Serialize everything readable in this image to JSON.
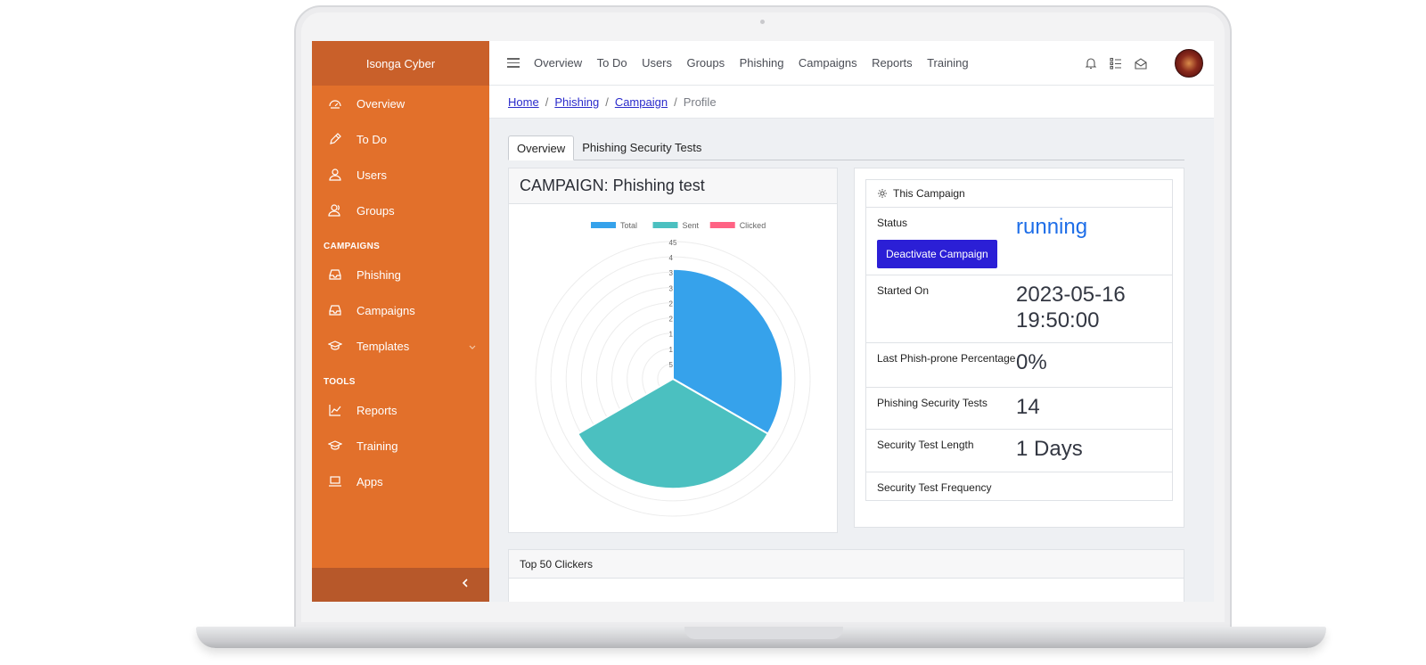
{
  "app": {
    "brand": "Isonga Cyber"
  },
  "sidebar": {
    "items": [
      {
        "label": "Overview",
        "icon": "dashboard-icon"
      },
      {
        "label": "To Do",
        "icon": "pencil-icon"
      },
      {
        "label": "Users",
        "icon": "user-icon"
      },
      {
        "label": "Groups",
        "icon": "group-icon"
      }
    ],
    "campaigns_heading": "CAMPAIGNS",
    "campaign_items": [
      {
        "label": "Phishing",
        "icon": "inbox-icon"
      },
      {
        "label": "Campaigns",
        "icon": "inbox-icon"
      },
      {
        "label": "Templates",
        "icon": "graduation-icon"
      }
    ],
    "tools_heading": "TOOLS",
    "tool_items": [
      {
        "label": "Reports",
        "icon": "chart-line-icon"
      },
      {
        "label": "Training",
        "icon": "graduation-icon"
      },
      {
        "label": "Apps",
        "icon": "laptop-icon"
      }
    ]
  },
  "topnav": [
    "Overview",
    "To Do",
    "Users",
    "Groups",
    "Phishing",
    "Campaigns",
    "Reports",
    "Training"
  ],
  "breadcrumb": {
    "home": "Home",
    "phishing": "Phishing",
    "campaign": "Campaign",
    "current": "Profile"
  },
  "tabs": [
    "Overview",
    "Phishing Security Tests"
  ],
  "campaign_card": {
    "title": "CAMPAIGN: Phishing test"
  },
  "info": {
    "heading": "This Campaign",
    "status_label": "Status",
    "status_value": "running",
    "deactivate_label": "Deactivate Campaign",
    "started_label": "Started On",
    "started_date": "2023-05-16",
    "started_time": "19:50:00",
    "phish_prone_label": "Last Phish-prone Percentage",
    "phish_prone_value": "0%",
    "tests_label": "Phishing Security Tests",
    "tests_value": "14",
    "length_label": "Security Test Length",
    "length_value": "1 Days",
    "frequency_label": "Security Test Frequency"
  },
  "clickers": {
    "title": "Top 50 Clickers"
  },
  "chart_data": {
    "type": "polar-area",
    "series": [
      {
        "name": "Total",
        "value": 36,
        "color": "#36a2eb"
      },
      {
        "name": "Sent",
        "value": 36,
        "color": "#4bc0c0"
      },
      {
        "name": "Clicked",
        "value": 0,
        "color": "#ff6384"
      }
    ],
    "r_ticks": [
      "45",
      "4",
      "3",
      "3",
      "2",
      "2",
      "1",
      "1",
      "5"
    ],
    "r_max": 45
  }
}
